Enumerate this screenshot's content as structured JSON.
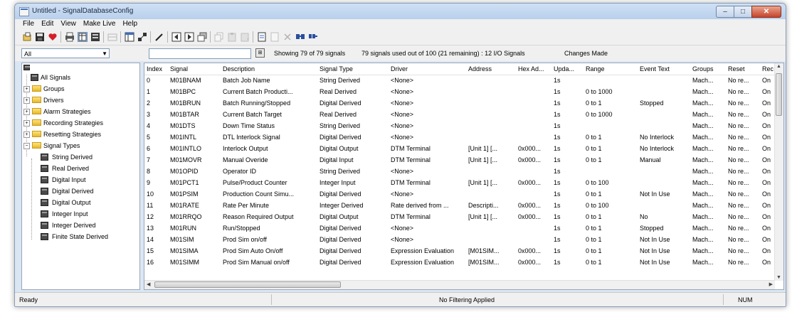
{
  "window": {
    "title": "Untitled - SignalDatabaseConfig",
    "controls": {
      "minimize": "–",
      "maximize": "□",
      "close": "✕"
    }
  },
  "menu": [
    "File",
    "Edit",
    "View",
    "Make Live",
    "Help"
  ],
  "toolbar": {
    "icons": [
      "open-icon",
      "save-icon",
      "heart-icon",
      "print-icon",
      "view-grid-icon",
      "view-list-icon",
      "disabled-table-icon",
      "table-icon",
      "connect-icon",
      "edit-pen-icon",
      "prev-record-icon",
      "next-record-icon",
      "copy-window-icon",
      "copy-icon",
      "paste-icon",
      "paste-special-icon",
      "new-document-icon",
      "disabled-doc-icon",
      "delete-x-icon",
      "find-icon",
      "find-replace-icon"
    ]
  },
  "filterbar": {
    "group_value": "All",
    "search_value": "",
    "showing": "Showing 79 of 79 signals",
    "usage": "79 signals used out of 100 (21 remaining) :  12 I/O Signals",
    "changes": "Changes Made"
  },
  "tree": {
    "root": "All Signals",
    "folders": [
      "Groups",
      "Drivers",
      "Alarm Strategies",
      "Recording Strategies",
      "Resetting Strategies",
      "Signal Types"
    ],
    "signal_types": [
      "String Derived",
      "Real Derived",
      "Digital Input",
      "Digital Derived",
      "Digital Output",
      "Integer Input",
      "Integer Derived",
      "Finite State Derived"
    ]
  },
  "grid": {
    "columns": [
      "Index",
      "Signal",
      "Description",
      "Signal Type",
      "Driver",
      "Address",
      "Hex Ad...",
      "Upda...",
      "Range",
      "Event Text",
      "Groups",
      "Reset",
      "Rec"
    ],
    "rows": [
      [
        "0",
        "M01BNAM",
        "Batch Job Name",
        "String Derived",
        "<None>",
        "",
        "",
        "1s",
        "",
        "",
        "Mach...",
        "No re...",
        "On"
      ],
      [
        "1",
        "M01BPC",
        "Current Batch Producti...",
        "Real Derived",
        "<None>",
        "",
        "",
        "1s",
        "0 to 1000",
        "",
        "Mach...",
        "No re...",
        "On"
      ],
      [
        "2",
        "M01BRUN",
        "Batch Running/Stopped",
        "Digital Derived",
        "<None>",
        "",
        "",
        "1s",
        "0 to 1",
        "Stopped",
        "Mach...",
        "No re...",
        "On"
      ],
      [
        "3",
        "M01BTAR",
        "Current Batch Target",
        "Real Derived",
        "<None>",
        "",
        "",
        "1s",
        "0 to 1000",
        "",
        "Mach...",
        "No re...",
        "On"
      ],
      [
        "4",
        "M01DTS",
        "Down Time Status",
        "String Derived",
        "<None>",
        "",
        "",
        "1s",
        "",
        "",
        "Mach...",
        "No re...",
        "On"
      ],
      [
        "5",
        "M01INTL",
        "DTL Interlock Signal",
        "Digital Derived",
        "<None>",
        "",
        "",
        "1s",
        "0 to 1",
        "No Interlock",
        "Mach...",
        "No re...",
        "On"
      ],
      [
        "6",
        "M01INTLO",
        "Interlock Output",
        "Digital Output",
        "DTM Terminal",
        "[Unit 1] [...",
        "0x000...",
        "1s",
        "0 to 1",
        "No Interlock",
        "Mach...",
        "No re...",
        "On"
      ],
      [
        "7",
        "M01MOVR",
        "Manual Overide",
        "Digital Input",
        "DTM Terminal",
        "[Unit 1] [...",
        "0x000...",
        "1s",
        "0 to 1",
        "Manual",
        "Mach...",
        "No re...",
        "On"
      ],
      [
        "8",
        "M01OPID",
        "Operator ID",
        "String Derived",
        "<None>",
        "",
        "",
        "1s",
        "",
        "",
        "Mach...",
        "No re...",
        "On"
      ],
      [
        "9",
        "M01PCT1",
        "Pulse/Product Counter",
        "Integer Input",
        "DTM Terminal",
        "[Unit 1] [...",
        "0x000...",
        "1s",
        "0 to 100",
        "",
        "Mach...",
        "No re...",
        "On"
      ],
      [
        "10",
        "M01PSIM",
        "Production Count Simu...",
        "Digital Derived",
        "<None>",
        "",
        "",
        "1s",
        "0 to 1",
        "Not In Use",
        "Mach...",
        "No re...",
        "On"
      ],
      [
        "11",
        "M01RATE",
        "Rate Per Minute",
        "Integer Derived",
        "Rate derived from ...",
        "Descripti...",
        "0x000...",
        "1s",
        "0 to 100",
        "",
        "Mach...",
        "No re...",
        "On"
      ],
      [
        "12",
        "M01RRQO",
        "Reason Required Output",
        "Digital Output",
        "DTM Terminal",
        "[Unit 1] [...",
        "0x000...",
        "1s",
        "0 to 1",
        "No",
        "Mach...",
        "No re...",
        "On"
      ],
      [
        "13",
        "M01RUN",
        "Run/Stopped",
        "Digital Derived",
        "<None>",
        "",
        "",
        "1s",
        "0 to 1",
        "Stopped",
        "Mach...",
        "No re...",
        "On"
      ],
      [
        "14",
        "M01SIM",
        "Prod Sim on/off",
        "Digital Derived",
        "<None>",
        "",
        "",
        "1s",
        "0 to 1",
        "Not In Use",
        "Mach...",
        "No re...",
        "On"
      ],
      [
        "15",
        "M01SIMA",
        "Prod Sim Auto On/off",
        "Digital Derived",
        "Expression Evaluation",
        "[M01SIM...",
        "0x000...",
        "1s",
        "0 to 1",
        "Not In Use",
        "Mach...",
        "No re...",
        "On"
      ],
      [
        "16",
        "M01SIMM",
        "Prod Sim Manual on/off",
        "Digital Derived",
        "Expression Evaluation",
        "[M01SIM...",
        "0x000...",
        "1s",
        "0 to 1",
        "Not In Use",
        "Mach...",
        "No re...",
        "On"
      ]
    ]
  },
  "status": {
    "ready": "Ready",
    "filter": "No Filtering Applied",
    "num": "NUM"
  }
}
